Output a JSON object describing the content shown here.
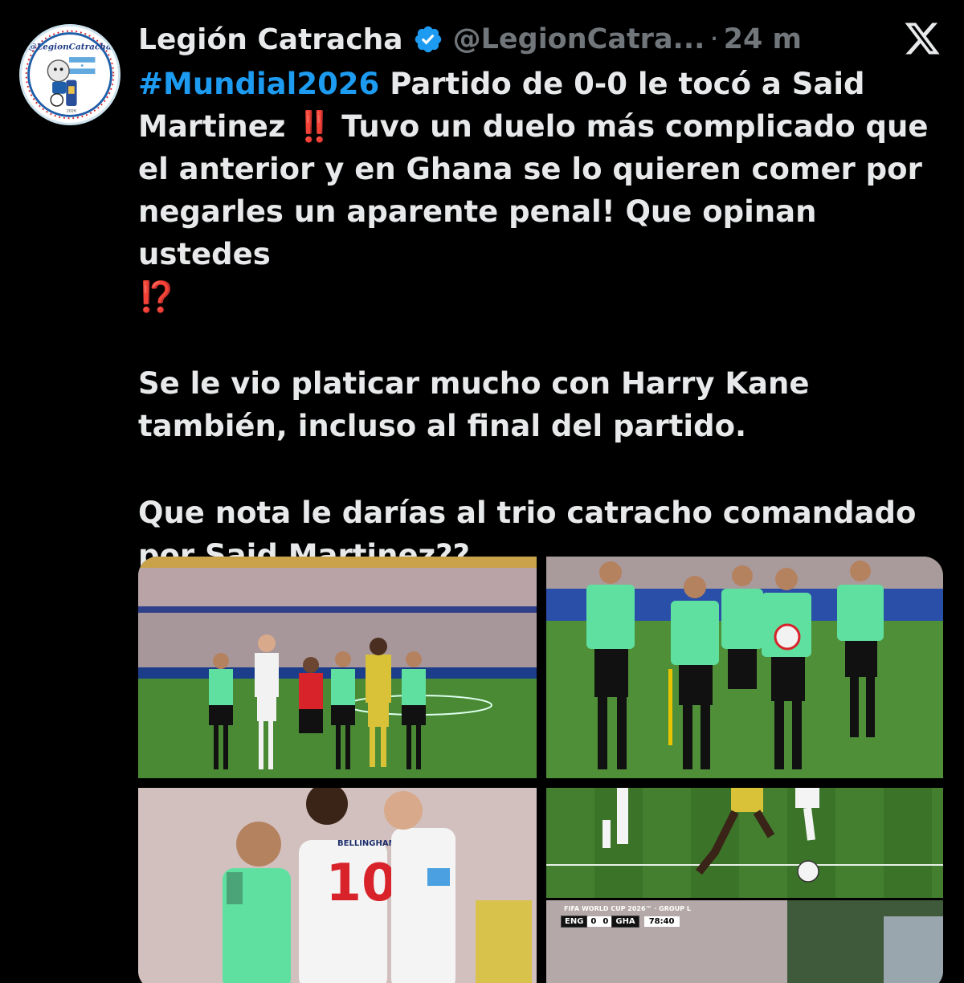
{
  "tweet": {
    "author_name": "Legión Catracha",
    "handle": "@LegionCatra...",
    "separator": "·",
    "time": "24 m",
    "hashtag": "#Mundial2026",
    "line1_rest": " Partido de 0-0 le tocó a Said Martinez",
    "emoji_double_exclamation": "‼️",
    "line1_after": " Tuvo un duelo más complicado que el anterior y en Ghana se lo quieren comer por negarles un aparente penal! Que opinan ustedes ",
    "emoji_interrobang": "⁉️",
    "paragraph2": "Se le vio platicar mucho con Harry Kane también, incluso al final del partido.",
    "paragraph3": "Que nota le darías al trio catracho comandado por Said Martinez??"
  },
  "avatar": {
    "text": "@LegionCatracha"
  },
  "media": {
    "count": 5,
    "scorebug": {
      "title": "FIFA WORLD CUP 2026™ · GROUP L",
      "home": "ENG",
      "home_score": "0",
      "away_score": "0",
      "away": "GHA",
      "clock": "78:40"
    },
    "jersey_number": "10",
    "jersey_name": "BELLINGHAM"
  },
  "colors": {
    "background": "#000000",
    "text": "#e7e9ea",
    "secondary": "#71767b",
    "link": "#1d9bf0",
    "verified": "#1d9bf0",
    "emoji_red": "#f4212e",
    "referee_shirt": "#5fe0a0",
    "pitch": "#3f7d2c"
  },
  "icons": {
    "verified": "verified-badge-icon",
    "x_logo": "x-logo-icon"
  }
}
